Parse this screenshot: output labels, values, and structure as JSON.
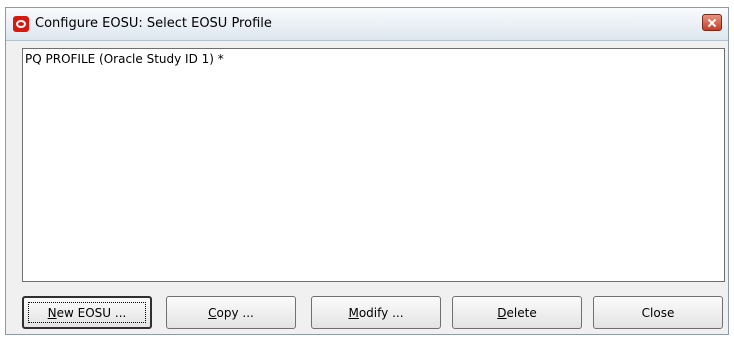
{
  "window": {
    "title": "Configure EOSU: Select EOSU Profile"
  },
  "profiles": {
    "items": [
      "PQ PROFILE (Oracle Study ID 1) *"
    ]
  },
  "buttons": {
    "new_eosu": {
      "mnemonic": "N",
      "rest": "ew EOSU ..."
    },
    "copy": {
      "mnemonic": "C",
      "rest": "opy ..."
    },
    "modify": {
      "mnemonic": "M",
      "rest": "odify ..."
    },
    "delete": {
      "mnemonic": "D",
      "rest": "elete"
    },
    "close": {
      "label": "Close"
    }
  }
}
